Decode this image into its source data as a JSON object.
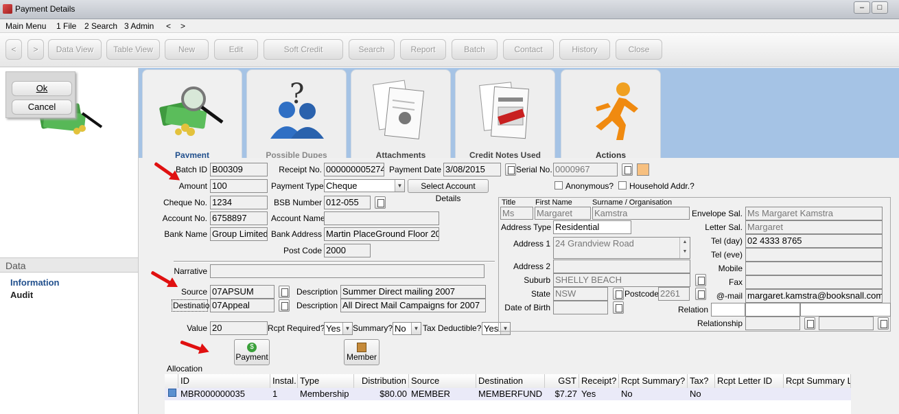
{
  "window": {
    "title": "Payment Details",
    "min": "–",
    "max": "□",
    "close": "✕"
  },
  "menu": [
    "Main Menu",
    "1 File",
    "2 Search",
    "3 Admin",
    "<",
    ">"
  ],
  "toolbar": {
    "back": "<",
    "fwd": ">",
    "buttons": [
      "Data View",
      "Table View",
      "New",
      "Edit",
      "Soft Credit",
      "Search",
      "Report",
      "Batch",
      "Contact",
      "History",
      "Close"
    ]
  },
  "dialog": {
    "ok": "Ok",
    "cancel": "Cancel"
  },
  "left": {
    "header": "Data",
    "links": [
      "Information",
      "Audit"
    ]
  },
  "tabs": [
    "Payment",
    "Possible Dupes",
    "Attachments",
    "Credit Notes Used",
    "Actions"
  ],
  "tab_icons": [
    "money-magnifier-icon",
    "dupes-people-icon",
    "invoice-attachments-icon",
    "invoice-credit-icon",
    "running-man-icon"
  ],
  "form": {
    "batch_id_label": "Batch ID",
    "batch_id": "B00309",
    "receipt_no_label": "Receipt No.",
    "receipt_no": "000000005274",
    "payment_date_label": "Payment Date",
    "payment_date": "3/08/2015",
    "serial_no_label": "Serial No.",
    "serial_no": "0000967",
    "amount_label": "Amount",
    "amount": "100",
    "payment_type_label": "Payment Type",
    "payment_type": "Cheque",
    "select_account": "Select Account Details",
    "anonymous": "Anonymous?",
    "household": "Household Addr.?",
    "cheque_no_label": "Cheque No.",
    "cheque_no": "1234",
    "bsb_label": "BSB Number",
    "bsb": "012-055",
    "account_no_label": "Account No.",
    "account_no": "6758897",
    "account_name_label": "Account Name",
    "account_name": "",
    "bank_name_label": "Bank Name",
    "bank_name": "Group Limited",
    "bank_address_label": "Bank Address",
    "bank_address": "Martin PlaceGround Floor  20",
    "post_code_label": "Post Code",
    "post_code": "2000",
    "narrative_label": "Narrative",
    "narrative": "",
    "source_label": "Source",
    "source": "07APSUM",
    "source_desc_label": "Description",
    "source_desc": "Summer Direct mailing 2007",
    "dest_label": "Destination",
    "dest": "07Appeal",
    "dest_desc_label": "Description",
    "dest_desc": "All Direct Mail Campaigns for 2007",
    "value_label": "Value",
    "value": "20",
    "rcpt_required_label": "Rcpt Required?",
    "rcpt_required": "Yes",
    "summary_label": "Summary?",
    "summary": "No",
    "tax_deductible_label": "Tax Deductible?",
    "tax_deductible": "Yes",
    "payment_btn": "Payment",
    "member_btn": "Member",
    "allocation_label": "Allocation"
  },
  "contact": {
    "title_label": "Title",
    "title": "Ms",
    "first_label": "First Name",
    "first": "Margaret",
    "surname_label": "Surname / Organisation",
    "surname": "Kamstra",
    "addr_type_label": "Address Type",
    "addr_type": "Residential",
    "addr1_label": "Address 1",
    "addr1": "24 Grandview Road",
    "addr2_label": "Address 2",
    "addr2": "",
    "suburb_label": "Suburb",
    "suburb": "SHELLY BEACH",
    "state_label": "State",
    "state": "NSW",
    "postcode_label": "Postcode",
    "postcode": "2261",
    "dob_label": "Date of Birth",
    "dob": "",
    "env_sal_label": "Envelope Sal.",
    "env_sal": "Ms Margaret Kamstra",
    "letter_sal_label": "Letter Sal.",
    "letter_sal": "Margaret",
    "tel_day_label": "Tel (day)",
    "tel_day": "02 4333 8765",
    "tel_eve_label": "Tel (eve)",
    "tel_eve": "",
    "mobile_label": "Mobile",
    "mobile": "",
    "fax_label": "Fax",
    "fax": "",
    "email_label": "@-mail",
    "email": "margaret.kamstra@booksnall.com",
    "relation_label": "Relation",
    "relationship_label": "Relationship"
  },
  "grid": {
    "headers": [
      "ID",
      "Instal.",
      "Type",
      "Distribution",
      "Source",
      "Destination",
      "GST",
      "Receipt?",
      "Rcpt Summary?",
      "Tax?",
      "Rcpt Letter ID",
      "Rcpt Summary L"
    ],
    "rows": [
      [
        "MBR000000035",
        "1",
        "Membership",
        "$80.00",
        "MEMBER",
        "MEMBERFUND",
        "$7.27",
        "Yes",
        "No",
        "No",
        "",
        ""
      ]
    ]
  },
  "colors": {
    "accent_blue": "#a5c3e5",
    "link_blue": "#1f4e8c",
    "arrow_red": "#e01010"
  }
}
